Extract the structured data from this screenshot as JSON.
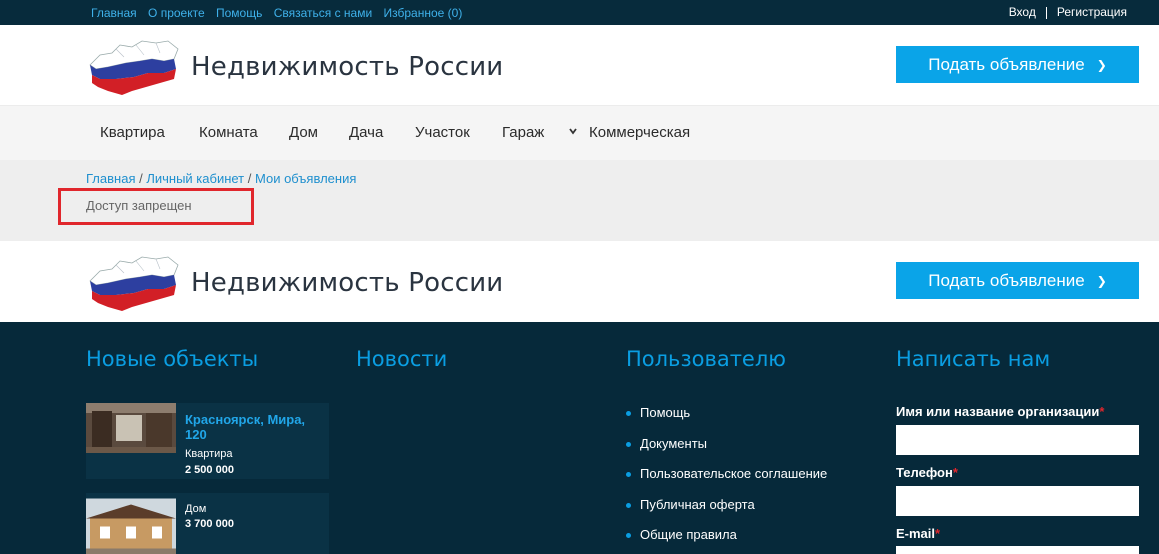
{
  "topbar": {
    "links": [
      "Главная",
      "О проекте",
      "Помощь",
      "Связаться с нами",
      "Избранное (0)"
    ],
    "login": "Вход",
    "register": "Регистрация"
  },
  "header": {
    "site_title": "Недвижимость России",
    "cta_label": "Подать объявление",
    "cta_icon": "chevron-right-icon"
  },
  "nav": {
    "items": [
      "Квартира",
      "Комната",
      "Дом",
      "Дача",
      "Участок",
      "Гараж",
      "Коммерческая"
    ]
  },
  "breadcrumb": {
    "home": "Главная",
    "sep1": " / ",
    "cabinet": "Личный кабинет",
    "sep2": " / ",
    "current": "Мои объявления"
  },
  "message": "Доступ запрещен",
  "footer_header": {
    "site_title": "Недвижимость России",
    "cta_label": "Подать объявление"
  },
  "footer": {
    "new_objects_title": "Новые объекты",
    "news_title": "Новости",
    "user_title": "Пользователю",
    "contact_title": "Написать нам",
    "properties": [
      {
        "title": "Красноярск, Мира, 120",
        "type": "Квартира",
        "price": "2 500 000"
      },
      {
        "title": "",
        "type": "Дом",
        "price": "3 700 000"
      }
    ],
    "user_links": [
      "Помощь",
      "Документы",
      "Пользовательское соглашение",
      "Публичная оферта",
      "Общие правила"
    ],
    "form": {
      "name_label": "Имя или название организации",
      "phone_label": "Телефон",
      "email_label": "E-mail",
      "required_mark": "*"
    }
  },
  "colors": {
    "dark_navy": "#072b3c",
    "accent_blue": "#0aa4e8",
    "highlight_red": "#e0262c"
  }
}
